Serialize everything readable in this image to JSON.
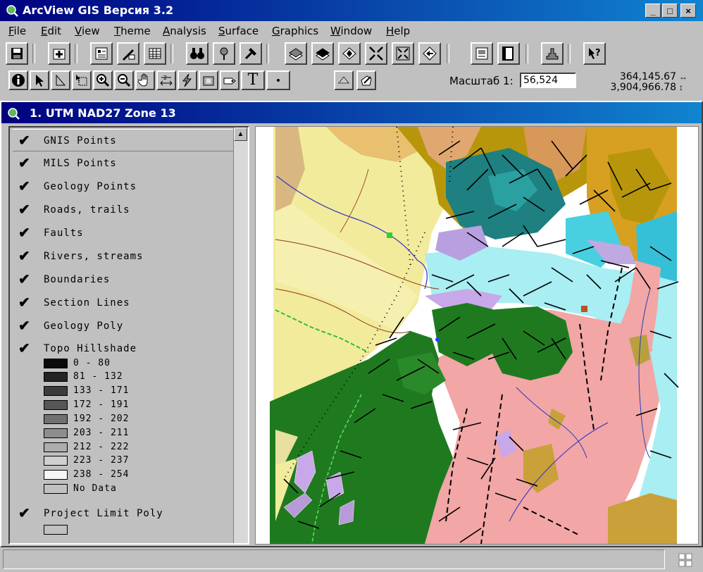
{
  "window": {
    "title": "ArcView GIS Версия 3.2",
    "minimize": "_",
    "maximize": "□",
    "close": "×"
  },
  "menu": [
    "File",
    "Edit",
    "View",
    "Theme",
    "Analysis",
    "Surface",
    "Graphics",
    "Window",
    "Help"
  ],
  "toolbar": {
    "scale_label": "Масштаб 1:",
    "scale_value": "56,524",
    "coord_x": "364,145.67",
    "coord_y": "3,904,966.78",
    "text_tool": "T"
  },
  "view": {
    "title": "1. UTM NAD27 Zone 13"
  },
  "layers": [
    {
      "label": "GNIS Points",
      "checked": true
    },
    {
      "label": "MILS Points",
      "checked": true
    },
    {
      "label": "Geology Points",
      "checked": true
    },
    {
      "label": "Roads, trails",
      "checked": true
    },
    {
      "label": "Faults",
      "checked": true
    },
    {
      "label": "Rivers, streams",
      "checked": true
    },
    {
      "label": "Boundaries",
      "checked": true
    },
    {
      "label": "Section Lines",
      "checked": true
    },
    {
      "label": "Geology Poly",
      "checked": true
    },
    {
      "label": "Topo Hillshade",
      "checked": true
    }
  ],
  "hillshade_legend": [
    {
      "label": "0 - 80",
      "color": "#0a0a0a"
    },
    {
      "label": "81 - 132",
      "color": "#242424"
    },
    {
      "label": "133 - 171",
      "color": "#3c3c3c"
    },
    {
      "label": "172 - 191",
      "color": "#565656"
    },
    {
      "label": "192 - 202",
      "color": "#707070"
    },
    {
      "label": "203 - 211",
      "color": "#8e8e8e"
    },
    {
      "label": "212 - 222",
      "color": "#adadad"
    },
    {
      "label": "223 - 237",
      "color": "#d0d0d0"
    },
    {
      "label": "238 - 254",
      "color": "#f6f6f6"
    },
    {
      "label": "No Data",
      "color": "#c0c0c0"
    }
  ],
  "project_layer": {
    "label": "Project Limit Poly",
    "checked": true,
    "swatch": "#c0c0c0"
  },
  "check_glyph": "✔",
  "colors": {
    "title_bar": "#000080",
    "map_yellow": "#f2eb9c",
    "map_green": "#1f7a1f",
    "map_pink": "#f2a6a6",
    "map_cyan": "#a8eef2",
    "map_olive": "#b8960c",
    "map_purple": "#b8a0e0"
  }
}
